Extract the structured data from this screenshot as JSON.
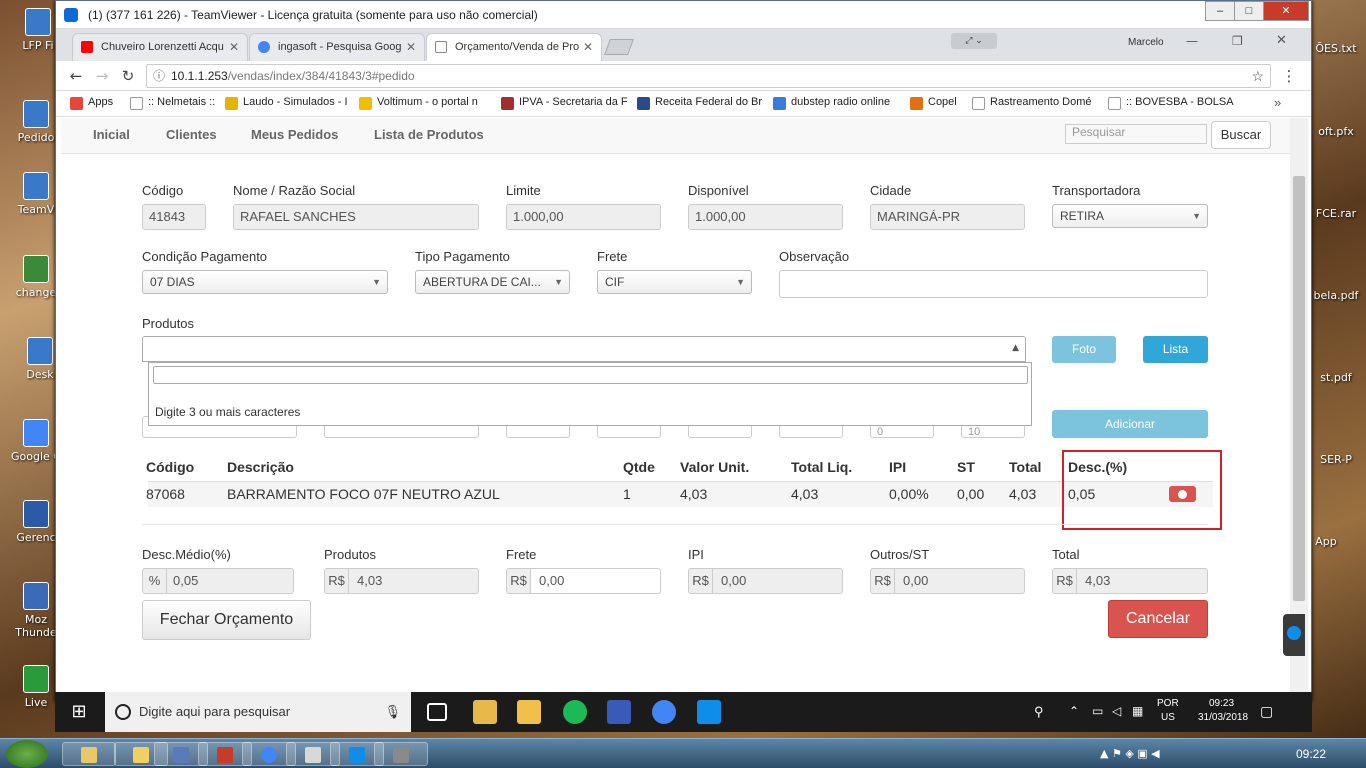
{
  "teamviewer": {
    "title": "(1) (377 161 226) - TeamViewer - Licença gratuita (somente para uso não comercial)"
  },
  "desktop": {
    "icons": [
      {
        "label": "LFP Fi",
        "side": "left"
      },
      {
        "label": "Pedido",
        "side": "left"
      },
      {
        "label": "TeamV",
        "side": "left"
      },
      {
        "label": "change",
        "side": "left"
      },
      {
        "label": "Desk",
        "side": "left"
      },
      {
        "label": "Google C",
        "side": "left"
      },
      {
        "label": "Gerenc",
        "side": "left"
      },
      {
        "label": "Moz Thunde",
        "side": "left"
      },
      {
        "label": "Live",
        "side": "left"
      },
      {
        "label": "ÕES.txt",
        "side": "right"
      },
      {
        "label": "oft.pfx",
        "side": "right"
      },
      {
        "label": "FCE.rar",
        "side": "right"
      },
      {
        "label": "bela.pdf",
        "side": "right"
      },
      {
        "label": "st.pdf",
        "side": "right"
      },
      {
        "label": "SER-P",
        "side": "right"
      },
      {
        "label": "App",
        "side": "right"
      }
    ]
  },
  "chrome": {
    "tabs": [
      {
        "label": "Chuveiro Lorenzetti Acqu",
        "icon": "youtube-icon",
        "color": "#ff0000"
      },
      {
        "label": "ingasoft - Pesquisa Goog",
        "icon": "google-icon",
        "color": "#4285f4"
      },
      {
        "label": "Orçamento/Venda de Pro",
        "icon": "page-icon",
        "color": "#888888"
      }
    ],
    "profile": "Marcelo",
    "url_host": "10.1.1.253",
    "url_path": "/vendas/index/384/41843/3#pedido",
    "bookmarks": [
      {
        "label": "Apps",
        "color": "#e8453c"
      },
      {
        "label": ":: Nelmetais ::",
        "color": "#999999"
      },
      {
        "label": "Laudo - Simulados - I",
        "color": "#e8b200"
      },
      {
        "label": "Voltimum - o portal n",
        "color": "#f0c000"
      },
      {
        "label": "IPVA - Secretaria da F",
        "color": "#a03030"
      },
      {
        "label": "Receita Federal do Br",
        "color": "#2a4a8a"
      },
      {
        "label": "dubstep radio online",
        "color": "#3a7ad8"
      },
      {
        "label": "Copel",
        "color": "#e07010"
      },
      {
        "label": "Rastreamento Domé",
        "color": "#999999"
      },
      {
        "label": ":: BOVESBA - BOLSA",
        "color": "#999999"
      }
    ]
  },
  "nav": {
    "items": [
      "Inicial",
      "Clientes",
      "Meus Pedidos",
      "Lista de Produtos"
    ],
    "search_placeholder": "Pesquisar",
    "search_button": "Buscar"
  },
  "form": {
    "codigo_label": "Código",
    "codigo": "41843",
    "nome_label": "Nome / Razão Social",
    "nome": "RAFAEL SANCHES",
    "limite_label": "Limite",
    "limite": "1.000,00",
    "disponivel_label": "Disponível",
    "disponivel": "1.000,00",
    "cidade_label": "Cidade",
    "cidade": "MARINGÁ-PR",
    "transportadora_label": "Transportadora",
    "transportadora": "RETIRA",
    "condicao_label": "Condição Pagamento",
    "condicao": "07 DIAS",
    "tipo_label": "Tipo Pagamento",
    "tipo": "ABERTURA DE CAI...",
    "frete_label": "Frete",
    "frete": "CIF",
    "observacao_label": "Observação",
    "observacao": "",
    "produtos_label": "Produtos",
    "dropdown_hint": "Digite 3 ou mais caracteres",
    "foto_button": "Foto",
    "lista_button": "Lista",
    "adicionar_button": "Adicionar",
    "hidden_vals": [
      "0",
      "10"
    ]
  },
  "table": {
    "headers": [
      "Código",
      "Descrição",
      "Qtde",
      "Valor Unit.",
      "Total Liq.",
      "IPI",
      "ST",
      "Total",
      "Desc.(%)"
    ],
    "rows": [
      [
        "87068",
        "BARRAMENTO FOCO 07F NEUTRO AZUL",
        "1",
        "4,03",
        "4,03",
        "0,00%",
        "0,00",
        "4,03",
        "0,05"
      ]
    ]
  },
  "totals": {
    "desc_label": "Desc.Médio(%)",
    "desc_prefix": "%",
    "desc": "0,05",
    "produtos_label": "Produtos",
    "produtos_prefix": "R$",
    "produtos": "4,03",
    "frete_label": "Frete",
    "frete_prefix": "R$",
    "frete": "0,00",
    "ipi_label": "IPI",
    "ipi_prefix": "R$",
    "ipi": "0,00",
    "outros_label": "Outros/ST",
    "outros_prefix": "R$",
    "outros": "0,00",
    "total_label": "Total",
    "total_prefix": "R$",
    "total": "4,03",
    "fechar_button": "Fechar Orçamento",
    "cancelar_button": "Cancelar"
  },
  "remote_taskbar": {
    "search_placeholder": "Digite aqui para pesquisar",
    "lang": "POR",
    "layout": "US",
    "time": "09:23",
    "date": "31/03/2018"
  },
  "local_taskbar": {
    "time": "09:22"
  }
}
